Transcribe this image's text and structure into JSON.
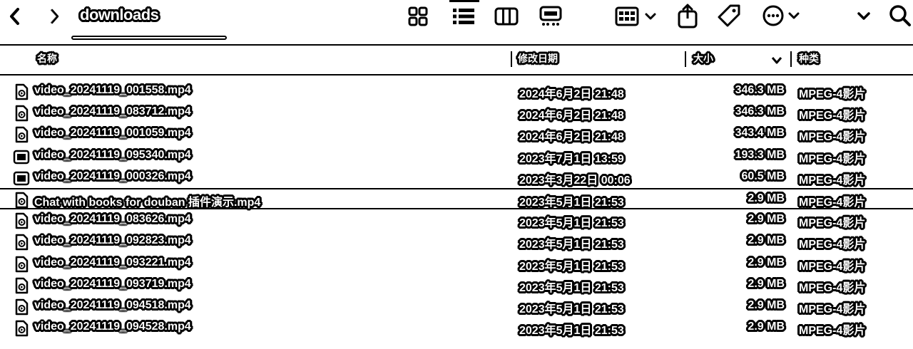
{
  "toolbar": {
    "title": "downloads"
  },
  "columns": {
    "name": "名称",
    "date": "修改日期",
    "size": "大小",
    "kind": "种类"
  },
  "files": [
    {
      "name": "video_20241119_001558.mp4",
      "date": "2024年6月2日 21:48",
      "size": "346.3 MB",
      "kind": "MPEG-4影片",
      "icon": "video-file-icon"
    },
    {
      "name": "video_20241119_083712.mp4",
      "date": "2024年6月2日 21:48",
      "size": "346.3 MB",
      "kind": "MPEG-4影片",
      "icon": "video-file-icon"
    },
    {
      "name": "video_20241119_001059.mp4",
      "date": "2024年6月2日 21:48",
      "size": "343.4 MB",
      "kind": "MPEG-4影片",
      "icon": "video-file-icon"
    },
    {
      "name": "video_20241119_095340.mp4",
      "date": "2023年7月1日 13:59",
      "size": "193.3 MB",
      "kind": "MPEG-4影片",
      "icon": "video-thumbnail-icon"
    },
    {
      "name": "video_20241119_000326.mp4",
      "date": "2023年3月22日 00:06",
      "size": "60.5 MB",
      "kind": "MPEG-4影片",
      "icon": "video-thumbnail-icon"
    },
    {
      "name": "Chat with books for douban 插件演示.mp4",
      "date": "2023年5月1日 21:53",
      "size": "2.9 MB",
      "kind": "MPEG-4影片",
      "icon": "video-file-icon"
    },
    {
      "name": "video_20241119_083626.mp4",
      "date": "2023年5月1日 21:53",
      "size": "2.9 MB",
      "kind": "MPEG-4影片",
      "icon": "video-file-icon"
    },
    {
      "name": "video_20241119_092823.mp4",
      "date": "2023年5月1日 21:53",
      "size": "2.9 MB",
      "kind": "MPEG-4影片",
      "icon": "video-file-icon"
    },
    {
      "name": "video_20241119_093221.mp4",
      "date": "2023年5月1日 21:53",
      "size": "2.9 MB",
      "kind": "MPEG-4影片",
      "icon": "video-file-icon"
    },
    {
      "name": "video_20241119_093719.mp4",
      "date": "2023年5月1日 21:53",
      "size": "2.9 MB",
      "kind": "MPEG-4影片",
      "icon": "video-file-icon"
    },
    {
      "name": "video_20241119_094518.mp4",
      "date": "2023年5月1日 21:53",
      "size": "2.9 MB",
      "kind": "MPEG-4影片",
      "icon": "video-file-icon"
    },
    {
      "name": "video_20241119_094528.mp4",
      "date": "2023年5月1日 21:53",
      "size": "2.9 MB",
      "kind": "MPEG-4影片",
      "icon": "video-file-icon"
    }
  ]
}
